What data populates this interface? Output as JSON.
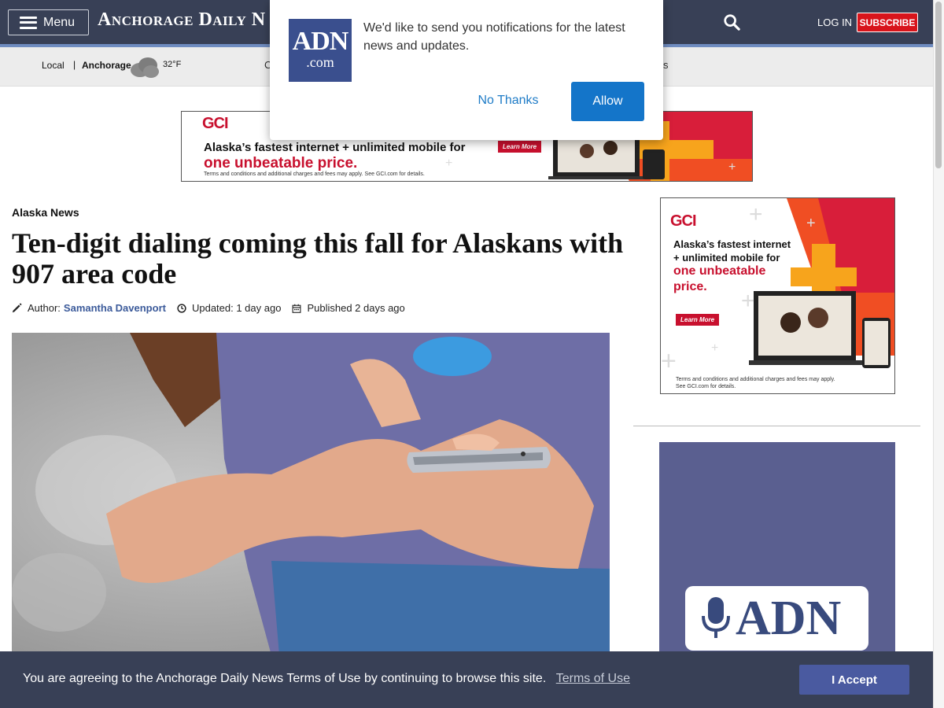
{
  "header": {
    "menu_label": "Menu",
    "logo_text": "Anchorage Daily N",
    "login_label": "LOG IN",
    "subscribe_label": "SUBSCRIBE",
    "search_icon": "search-icon",
    "brand_color": "#384056",
    "subscribe_color": "#d8141b"
  },
  "subnav": {
    "local_label": "Local",
    "separator": "|",
    "city": "Anchorage",
    "weather_icon": "cloud-icon",
    "temperature": "32°F",
    "partial_left": "C",
    "partial_right": "s"
  },
  "notification": {
    "logo_top": "ADN",
    "logo_bottom": ".com",
    "message": "We'd like to send you notifications for the latest news and updates.",
    "no_thanks_label": "No Thanks",
    "allow_label": "Allow",
    "allow_color": "#1475c9"
  },
  "ads": {
    "banner": {
      "brand": "GCI",
      "line1": "Alaska’s fastest internet + unlimited mobile for",
      "line2": "one unbeatable price.",
      "cta": "Learn More",
      "terms": "Terms and conditions and additional charges and fees may apply. See GCI.com for details."
    },
    "side": {
      "brand": "GCI",
      "line1": "Alaska’s fastest internet",
      "line2": "+ unlimited mobile for",
      "line3": "one unbeatable",
      "line4": "price.",
      "cta": "Learn More",
      "terms_line1": "Terms and conditions and additional charges and fees may apply.",
      "terms_line2": "See GCI.com for details."
    },
    "podcast": {
      "text": "ADN",
      "icon": "microphone-icon",
      "bg_color": "#5a5f90"
    }
  },
  "article": {
    "section": "Alaska News",
    "headline": "Ten-digit dialing coming this fall for Alaskans with 907 area code",
    "author_prefix": "Author:",
    "author_name": "Samantha Davenport",
    "updated": "Updated: 1 day ago",
    "published": "Published 2 days ago",
    "hero_image": "person-texting-on-smartphone-photo"
  },
  "cookie_bar": {
    "message": "You are agreeing to the Anchorage Daily News Terms of Use by continuing to browse this site.",
    "terms_link": "Terms of Use",
    "accept_label": "I Accept"
  }
}
